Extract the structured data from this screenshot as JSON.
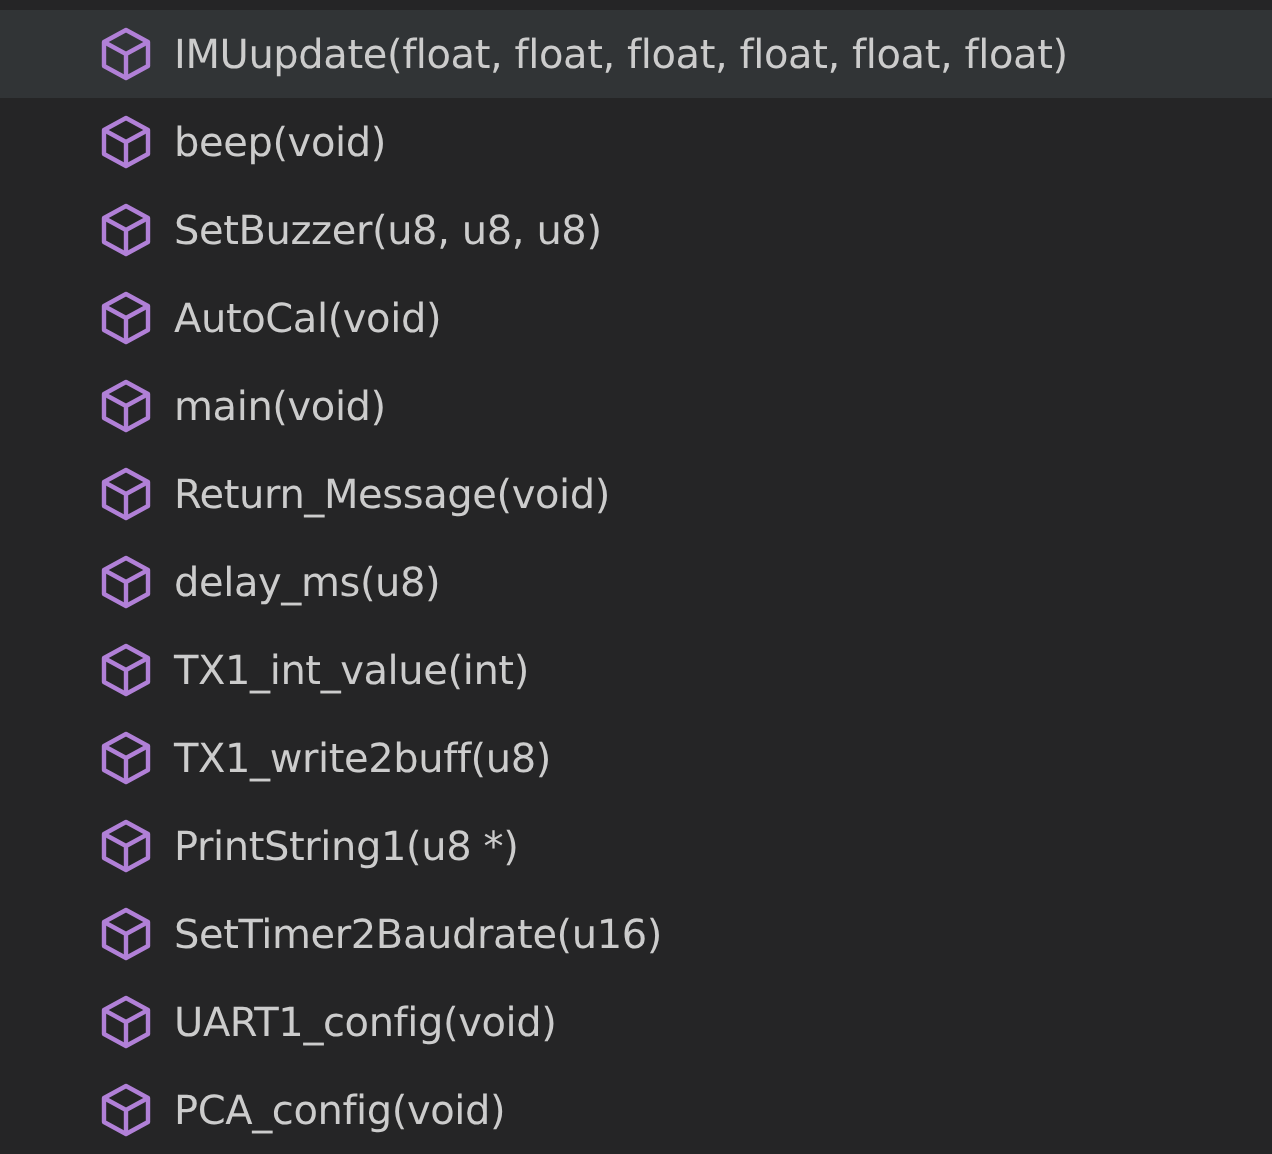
{
  "symbols": [
    {
      "label": "IMUupdate(float, float, float, float, float, float)",
      "selected": true
    },
    {
      "label": "beep(void)",
      "selected": false
    },
    {
      "label": "SetBuzzer(u8, u8, u8)",
      "selected": false
    },
    {
      "label": "AutoCal(void)",
      "selected": false
    },
    {
      "label": "main(void)",
      "selected": false
    },
    {
      "label": "Return_Message(void)",
      "selected": false
    },
    {
      "label": "delay_ms(u8)",
      "selected": false
    },
    {
      "label": "TX1_int_value(int)",
      "selected": false
    },
    {
      "label": "TX1_write2buff(u8)",
      "selected": false
    },
    {
      "label": "PrintString1(u8 *)",
      "selected": false
    },
    {
      "label": "SetTimer2Baudrate(u16)",
      "selected": false
    },
    {
      "label": "UART1_config(void)",
      "selected": false
    },
    {
      "label": "PCA_config(void)",
      "selected": false
    }
  ]
}
